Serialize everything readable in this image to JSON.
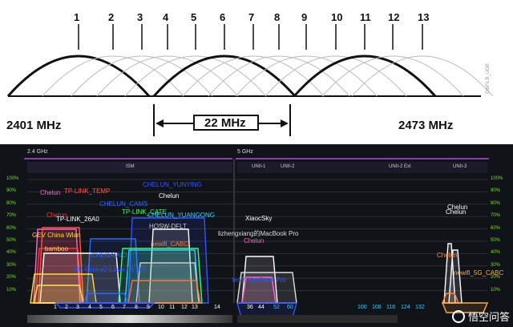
{
  "top": {
    "channels": [
      "1",
      "2",
      "3",
      "4",
      "5",
      "6",
      "7",
      "8",
      "9",
      "10",
      "11",
      "12",
      "13"
    ],
    "freq_left": "2401 MHz",
    "freq_right": "2473 MHz",
    "bandwidth": "22 MHz",
    "watermark": "EthFiLB_UOB"
  },
  "analyzer": {
    "band_24": "2.4 GHz",
    "band_5": "5 GHz",
    "ism": "ISM",
    "unii1": "UNII-1",
    "unii2": "UNII-2",
    "unii2ext": "UNII-2 Ext",
    "unii3": "UNII-3",
    "yaxis": [
      "100%",
      "90%",
      "80%",
      "70%",
      "60%",
      "50%",
      "40%",
      "30%",
      "20%",
      "10%"
    ],
    "channels_24": [
      "1",
      "2",
      "3",
      "4",
      "5",
      "6",
      "7",
      "8",
      "9",
      "10",
      "11",
      "12",
      "13",
      "14"
    ],
    "channels_5": [
      "36",
      "44",
      "52",
      "60",
      "100",
      "108",
      "116",
      "124",
      "132"
    ],
    "networks": [
      {
        "name": "Chelun",
        "color": "#ff66cc"
      },
      {
        "name": "TP-LINK_TEMP",
        "color": "#ff5544"
      },
      {
        "name": "CHELUN_YUNYING",
        "color": "#3355ff"
      },
      {
        "name": "Chelun",
        "color": "#ffffff"
      },
      {
        "name": "CHELUN_CAMS",
        "color": "#3366ff"
      },
      {
        "name": "Chelun",
        "color": "#ff3333"
      },
      {
        "name": "TP-LINK_26A0",
        "color": "#ffffff"
      },
      {
        "name": "TP-LINK_CATE",
        "color": "#33ff66"
      },
      {
        "name": "CHELUN_YUANGONG",
        "color": "#33ccff"
      },
      {
        "name": "HQSW-DFLT",
        "color": "#cccccc"
      },
      {
        "name": "GEV China Wlan",
        "color": "#ffdd33"
      },
      {
        "name": "bamboo",
        "color": "#ffdd55"
      },
      {
        "name": "newifi_CABC",
        "color": "#ff7733"
      },
      {
        "name": "CHEGAIAIO",
        "color": "#3366ff"
      },
      {
        "name": "HP-Print-e2-LaserJet 200",
        "color": "#3355ff"
      },
      {
        "name": "XiaocSky",
        "color": "#ffffff"
      },
      {
        "name": "lizhengxiang的MacBook Pro",
        "color": "#dddddd"
      },
      {
        "name": "Chelun",
        "color": "#ff66cc"
      },
      {
        "name": "leo的MacBook Pro",
        "color": "#3355ff"
      },
      {
        "name": "Chelun",
        "color": "#ffffff"
      },
      {
        "name": "Chelun",
        "color": "#ffffff"
      },
      {
        "name": "Chelun",
        "color": "#ff8844"
      },
      {
        "name": "newifi_5G_CABC",
        "color": "#ffaa44"
      }
    ],
    "watermark_text": "悟空问答"
  }
}
